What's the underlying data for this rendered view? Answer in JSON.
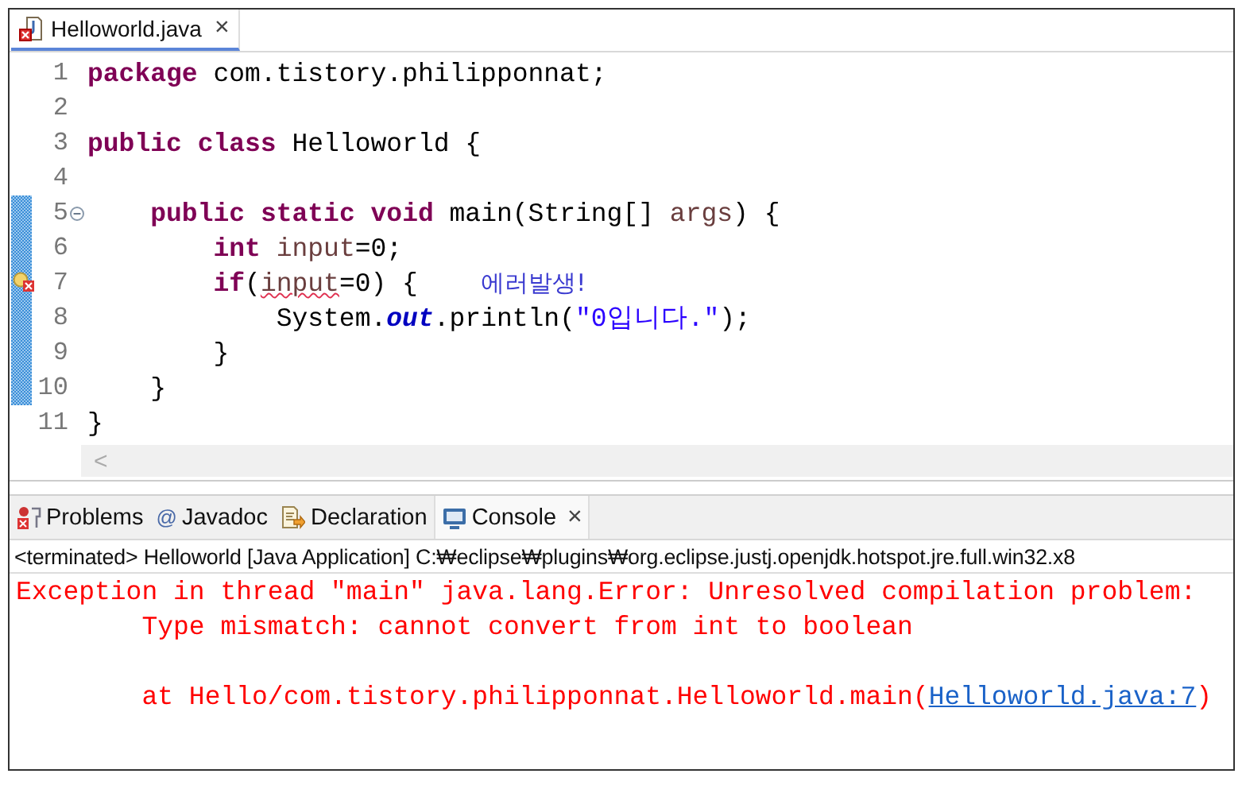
{
  "editor_tab": {
    "title": "Helloworld.java",
    "selected": true,
    "close": "×"
  },
  "code_lines": [
    {
      "number": "1",
      "fold": false,
      "error": false,
      "changed": false,
      "tokens": [
        {
          "kind": "keyword",
          "text": "package"
        },
        {
          "kind": "plain",
          "text": " com.tistory.philipponnat;"
        }
      ]
    },
    {
      "number": "2",
      "fold": false,
      "error": false,
      "changed": false
    },
    {
      "number": "3",
      "fold": false,
      "error": false,
      "changed": false,
      "tokens": [
        {
          "kind": "keyword",
          "text": "public"
        },
        {
          "kind": "keyword",
          "text": " class"
        },
        {
          "kind": "plain",
          "text": " Helloworld {"
        }
      ]
    },
    {
      "number": "4",
      "fold": false,
      "error": false,
      "changed": false
    },
    {
      "number": "5",
      "fold": true,
      "error": false,
      "changed": true,
      "tokens": [
        {
          "kind": "keyword",
          "text": "    public"
        },
        {
          "kind": "keyword",
          "text": " static"
        },
        {
          "kind": "keyword",
          "text": " void"
        },
        {
          "kind": "plain",
          "text": " main(String[]"
        },
        {
          "kind": "variable",
          "text": " args"
        },
        {
          "kind": "plain",
          "text": ") {"
        }
      ]
    },
    {
      "number": "6",
      "fold": false,
      "error": false,
      "changed": true,
      "tokens": [
        {
          "kind": "keyword",
          "text": "        int"
        },
        {
          "kind": "variable",
          "text": " input"
        },
        {
          "kind": "plain",
          "text": "=0;"
        }
      ]
    },
    {
      "number": "7",
      "fold": false,
      "error": true,
      "changed": true,
      "tokens": [
        {
          "kind": "keyword",
          "text": "        if"
        },
        {
          "kind": "plain",
          "text": "("
        },
        {
          "kind": "error_variable",
          "text": "input"
        },
        {
          "kind": "plain",
          "text": "=0) {"
        },
        {
          "kind": "note",
          "text": "    에러발생!"
        }
      ]
    },
    {
      "number": "8",
      "fold": false,
      "error": false,
      "changed": true,
      "tokens": [
        {
          "kind": "plain",
          "text": "            System."
        },
        {
          "kind": "field",
          "text": "out"
        },
        {
          "kind": "plain",
          "text": ".println("
        },
        {
          "kind": "string",
          "text": "\"0입니다.\""
        },
        {
          "kind": "plain",
          "text": ");"
        }
      ]
    },
    {
      "number": "9",
      "fold": false,
      "error": false,
      "changed": true,
      "tokens": [
        {
          "kind": "plain",
          "text": "        }"
        }
      ]
    },
    {
      "number": "10",
      "fold": false,
      "error": false,
      "changed": true,
      "tokens": [
        {
          "kind": "plain",
          "text": "    }"
        }
      ]
    },
    {
      "number": "11",
      "fold": false,
      "error": false,
      "changed": false,
      "tokens": [
        {
          "kind": "plain",
          "text": "}"
        }
      ]
    }
  ],
  "horizontal_scrollbar": {
    "arrow": "<"
  },
  "view_tabs": [
    {
      "label": "Problems",
      "kind": "problems",
      "selected": false
    },
    {
      "label": "Javadoc",
      "kind": "javadoc",
      "glyph": "@",
      "selected": false
    },
    {
      "label": "Declaration",
      "kind": "declaration",
      "selected": false
    },
    {
      "label": "Console",
      "kind": "console",
      "selected": true,
      "close": "×"
    }
  ],
  "console": {
    "status": "<terminated> Helloworld [Java Application] C:₩eclipse₩plugins₩org.eclipse.justj.openjdk.hotspot.jre.full.win32.x8",
    "lines": [
      {
        "kind": "error",
        "text": "Exception in thread \"main\" java.lang.Error: Unresolved compilation problem: "
      },
      {
        "kind": "error",
        "text": "\tType mismatch: cannot convert from int to boolean"
      },
      {
        "kind": "blank"
      },
      {
        "kind": "trace",
        "text": "\tat Hello/com.tistory.philipponnat.Helloworld.main(",
        "link": "Helloworld.java:7",
        "after": ")"
      }
    ]
  }
}
